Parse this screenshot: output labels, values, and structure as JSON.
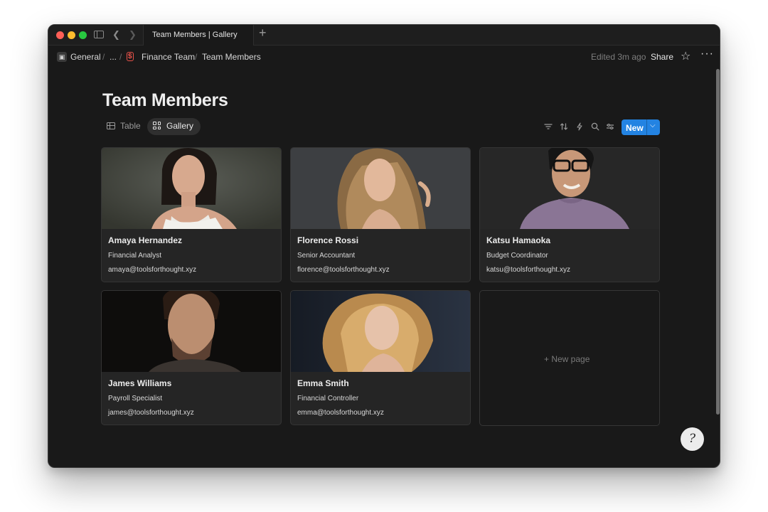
{
  "tab": {
    "title": "Team Members | Gallery",
    "add_icon": "plus-icon"
  },
  "breadcrumb": {
    "workspace": "General",
    "ellipsis": "...",
    "parent": "Finance Team",
    "current": "Team Members",
    "separator": "/"
  },
  "topbar": {
    "edited": "Edited 3m ago",
    "share_label": "Share"
  },
  "page": {
    "title": "Team Members"
  },
  "views": [
    {
      "label": "Table",
      "active": false
    },
    {
      "label": "Gallery",
      "active": true
    }
  ],
  "toolbar": {
    "new_label": "New"
  },
  "cards": [
    {
      "name": "Amaya Hernandez",
      "role": "Financial Analyst",
      "email": "amaya@toolsforthought.xyz"
    },
    {
      "name": "Florence Rossi",
      "role": "Senior Accountant",
      "email": "florence@toolsforthought.xyz"
    },
    {
      "name": "Katsu Hamaoka",
      "role": "Budget Coordinator",
      "email": "katsu@toolsforthought.xyz"
    },
    {
      "name": "James Williams",
      "role": "Payroll Specialist",
      "email": "james@toolsforthought.xyz"
    },
    {
      "name": "Emma Smith",
      "role": "Financial Controller",
      "email": "emma@toolsforthought.xyz"
    }
  ],
  "new_page": {
    "label": "+ New page"
  },
  "colors": {
    "accent": "#2383e2",
    "background": "#191919",
    "card": "#252525"
  }
}
